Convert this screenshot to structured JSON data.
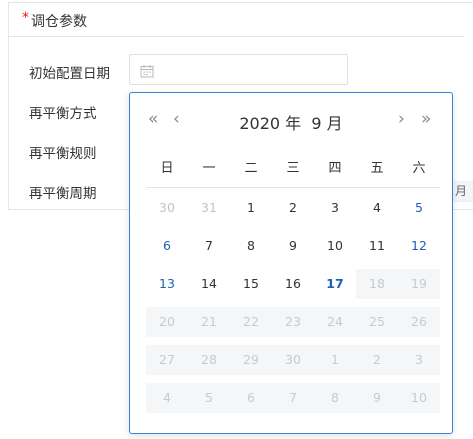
{
  "section": {
    "required_mark": "*",
    "title": "调仓参数"
  },
  "form": {
    "initial_date_label": "初始配置日期",
    "rebalance_method_label": "再平衡方式",
    "rebalance_rule_label": "再平衡规则",
    "rebalance_period_label": "再平衡周期",
    "date_input_value": "",
    "period_peek_text": "月"
  },
  "date_picker": {
    "prev_year_glyph": "«",
    "prev_month_glyph": "‹",
    "next_month_glyph": "›",
    "next_year_glyph": "»",
    "year_label": "2020 年",
    "month_label": "9 月",
    "weekdays": [
      "日",
      "一",
      "二",
      "三",
      "四",
      "五",
      "六"
    ],
    "weeks": [
      [
        {
          "d": "30",
          "s": "other"
        },
        {
          "d": "31",
          "s": "other"
        },
        {
          "d": "1",
          "s": ""
        },
        {
          "d": "2",
          "s": ""
        },
        {
          "d": "3",
          "s": ""
        },
        {
          "d": "4",
          "s": ""
        },
        {
          "d": "5",
          "s": "weekend"
        }
      ],
      [
        {
          "d": "6",
          "s": "weekend"
        },
        {
          "d": "7",
          "s": ""
        },
        {
          "d": "8",
          "s": ""
        },
        {
          "d": "9",
          "s": ""
        },
        {
          "d": "10",
          "s": ""
        },
        {
          "d": "11",
          "s": ""
        },
        {
          "d": "12",
          "s": "weekend"
        }
      ],
      [
        {
          "d": "13",
          "s": "weekend"
        },
        {
          "d": "14",
          "s": ""
        },
        {
          "d": "15",
          "s": ""
        },
        {
          "d": "16",
          "s": ""
        },
        {
          "d": "17",
          "s": "today"
        },
        {
          "d": "18",
          "s": "disabled"
        },
        {
          "d": "19",
          "s": "disabled"
        }
      ],
      [
        {
          "d": "20",
          "s": "disabled"
        },
        {
          "d": "21",
          "s": "disabled"
        },
        {
          "d": "22",
          "s": "disabled"
        },
        {
          "d": "23",
          "s": "disabled"
        },
        {
          "d": "24",
          "s": "disabled"
        },
        {
          "d": "25",
          "s": "disabled"
        },
        {
          "d": "26",
          "s": "disabled"
        }
      ],
      [
        {
          "d": "27",
          "s": "disabled"
        },
        {
          "d": "28",
          "s": "disabled"
        },
        {
          "d": "29",
          "s": "disabled"
        },
        {
          "d": "30",
          "s": "disabled"
        },
        {
          "d": "1",
          "s": "disabled"
        },
        {
          "d": "2",
          "s": "disabled"
        },
        {
          "d": "3",
          "s": "disabled"
        }
      ],
      [
        {
          "d": "4",
          "s": "disabled"
        },
        {
          "d": "5",
          "s": "disabled"
        },
        {
          "d": "6",
          "s": "disabled"
        },
        {
          "d": "7",
          "s": "disabled"
        },
        {
          "d": "8",
          "s": "disabled"
        },
        {
          "d": "9",
          "s": "disabled"
        },
        {
          "d": "10",
          "s": "disabled"
        }
      ]
    ]
  },
  "colors": {
    "accent": "#3f7fd9",
    "weekend_text": "#1f5fb3",
    "required": "#e02020",
    "disabled_bg": "#f5f6f8"
  }
}
